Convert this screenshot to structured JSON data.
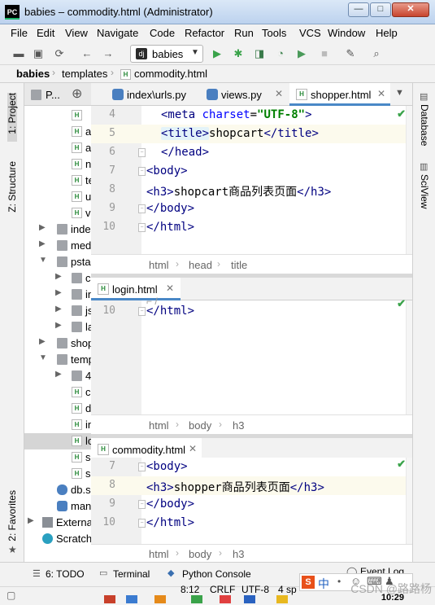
{
  "window": {
    "logo_text": "PC",
    "title": "babies – commodity.html (Administrator)",
    "min_glyph": "—",
    "max_glyph": "□",
    "close_glyph": "✕"
  },
  "menu": [
    "File",
    "Edit",
    "View",
    "Navigate",
    "Code",
    "Refactor",
    "Run",
    "Tools",
    "VCS",
    "Window",
    "Help"
  ],
  "toolbar": {
    "run_config_icon": "dj",
    "run_config": "babies"
  },
  "breadcrumb": [
    "babies",
    "templates",
    "commodity.html"
  ],
  "left_tools": {
    "project": "1: Project",
    "structure": "Z: Structure",
    "favorites": "2: Favorites"
  },
  "right_tools": {
    "database": "Database",
    "sciview": "SciView"
  },
  "project_panel": {
    "header": "P...",
    "rows": [
      {
        "label": "",
        "type": "hfile"
      },
      {
        "label": "a",
        "type": "hfile"
      },
      {
        "label": "a",
        "type": "hfile"
      },
      {
        "label": "n",
        "type": "hfile"
      },
      {
        "label": "te",
        "type": "hfile"
      },
      {
        "label": "u",
        "type": "hfile"
      },
      {
        "label": "v",
        "type": "hfile"
      },
      {
        "label": "inde",
        "type": "folder"
      },
      {
        "label": "med",
        "type": "folder"
      },
      {
        "label": "psta",
        "type": "folder"
      },
      {
        "label": "c",
        "type": "folder"
      },
      {
        "label": "in",
        "type": "folder"
      },
      {
        "label": "js",
        "type": "folder"
      },
      {
        "label": "la",
        "type": "folder"
      },
      {
        "label": "shop",
        "type": "folder"
      },
      {
        "label": "temp",
        "type": "folder"
      },
      {
        "label": "4",
        "type": "folder"
      },
      {
        "label": "c",
        "type": "hfile"
      },
      {
        "label": "d",
        "type": "hfile"
      },
      {
        "label": "in",
        "type": "hfile"
      },
      {
        "label": "lo",
        "type": "hfile"
      },
      {
        "label": "s",
        "type": "hfile"
      },
      {
        "label": "s",
        "type": "hfile"
      },
      {
        "label": "db.s",
        "type": "db"
      },
      {
        "label": "man",
        "type": "py"
      },
      {
        "label": "Externa",
        "type": "lib"
      },
      {
        "label": "Scratch",
        "type": "scratch"
      }
    ]
  },
  "tabs": [
    {
      "label": "index\\urls.py"
    },
    {
      "label": "views.py"
    },
    {
      "label": "shopper.html"
    }
  ],
  "pane1": {
    "lines": [
      {
        "n": "4",
        "code": "<meta charset=\"UTF-8\">"
      },
      {
        "n": "5",
        "code": "<title>shopcart</title>"
      },
      {
        "n": "6",
        "code": "</head>"
      },
      {
        "n": "7",
        "code": "<body>"
      },
      {
        "n": "8",
        "code": "<h3>shopcart商品列表页面</h3>"
      },
      {
        "n": "9",
        "code": "</body>"
      },
      {
        "n": "10",
        "code": "</html>"
      }
    ],
    "crumbs": [
      "html",
      "head",
      "title"
    ]
  },
  "pane2": {
    "tab": "login.html",
    "lines": [
      {
        "n": "10",
        "code": "</html>"
      }
    ],
    "crumbs": [
      "html",
      "body",
      "h3"
    ]
  },
  "pane3": {
    "tab": "commodity.html",
    "lines": [
      {
        "n": "7",
        "code": "<body>"
      },
      {
        "n": "8",
        "code": "<h3>shopper商品列表页面</h3>"
      },
      {
        "n": "9",
        "code": "</body>"
      },
      {
        "n": "10",
        "code": "</html>"
      }
    ],
    "crumbs": [
      "html",
      "body",
      "h3"
    ]
  },
  "bottom_tools": {
    "todo": "6: TODO",
    "terminal": "Terminal",
    "python_console": "Python Console",
    "event_log": "Event Log"
  },
  "status": {
    "position": "8:12",
    "line_sep": "CRLF",
    "encoding": "UTF-8",
    "indent": "4 sp"
  },
  "overlay": {
    "ime": "中",
    "watermark": "CSDN @路路杨",
    "clock": "10:29"
  }
}
